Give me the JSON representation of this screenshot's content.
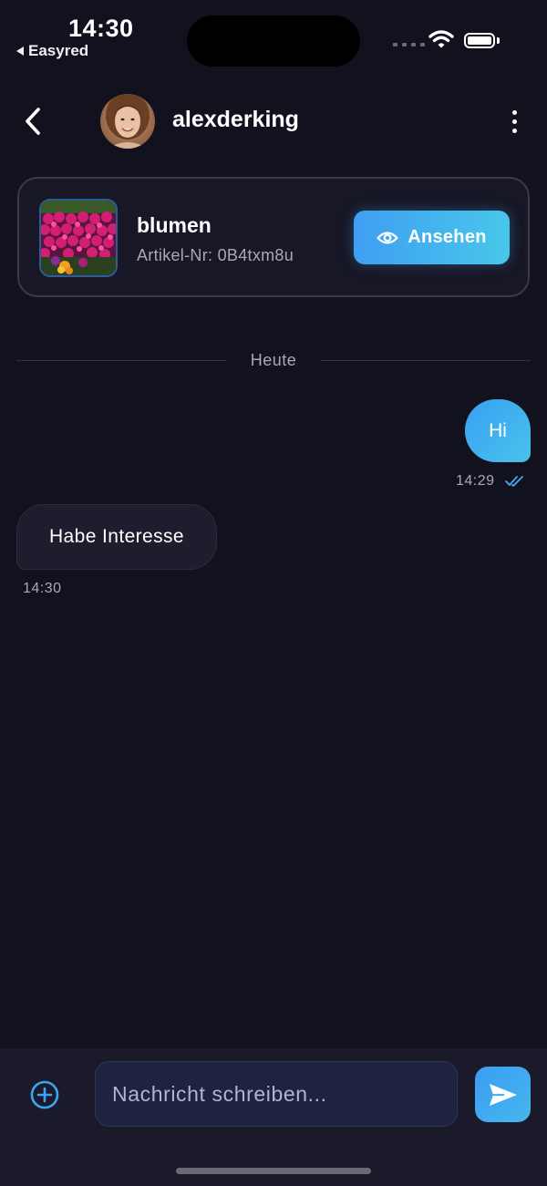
{
  "status_bar": {
    "time": "14:30",
    "back_app": "Easyred"
  },
  "header": {
    "username": "alexderking",
    "back_icon": "chevron-left-icon",
    "menu_icon": "more-vertical-icon"
  },
  "item_card": {
    "title": "blumen",
    "article_number": "Artikel-Nr: 0B4txm8u",
    "view_button": "Ansehen",
    "view_icon": "eye-icon"
  },
  "date_separator": "Heute",
  "messages": [
    {
      "direction": "outgoing",
      "text": "Hi",
      "time": "14:29",
      "status": "read"
    },
    {
      "direction": "incoming",
      "text": "Habe Interesse",
      "time": "14:30"
    }
  ],
  "composer": {
    "placeholder": "Nachricht schreiben...",
    "value": "",
    "add_icon": "plus-circle-icon",
    "send_icon": "send-icon"
  },
  "colors": {
    "background": "#12121f",
    "accent": "#3fa3f1",
    "accent_end": "#48c7ea",
    "muted_text": "#a8a8b8"
  }
}
